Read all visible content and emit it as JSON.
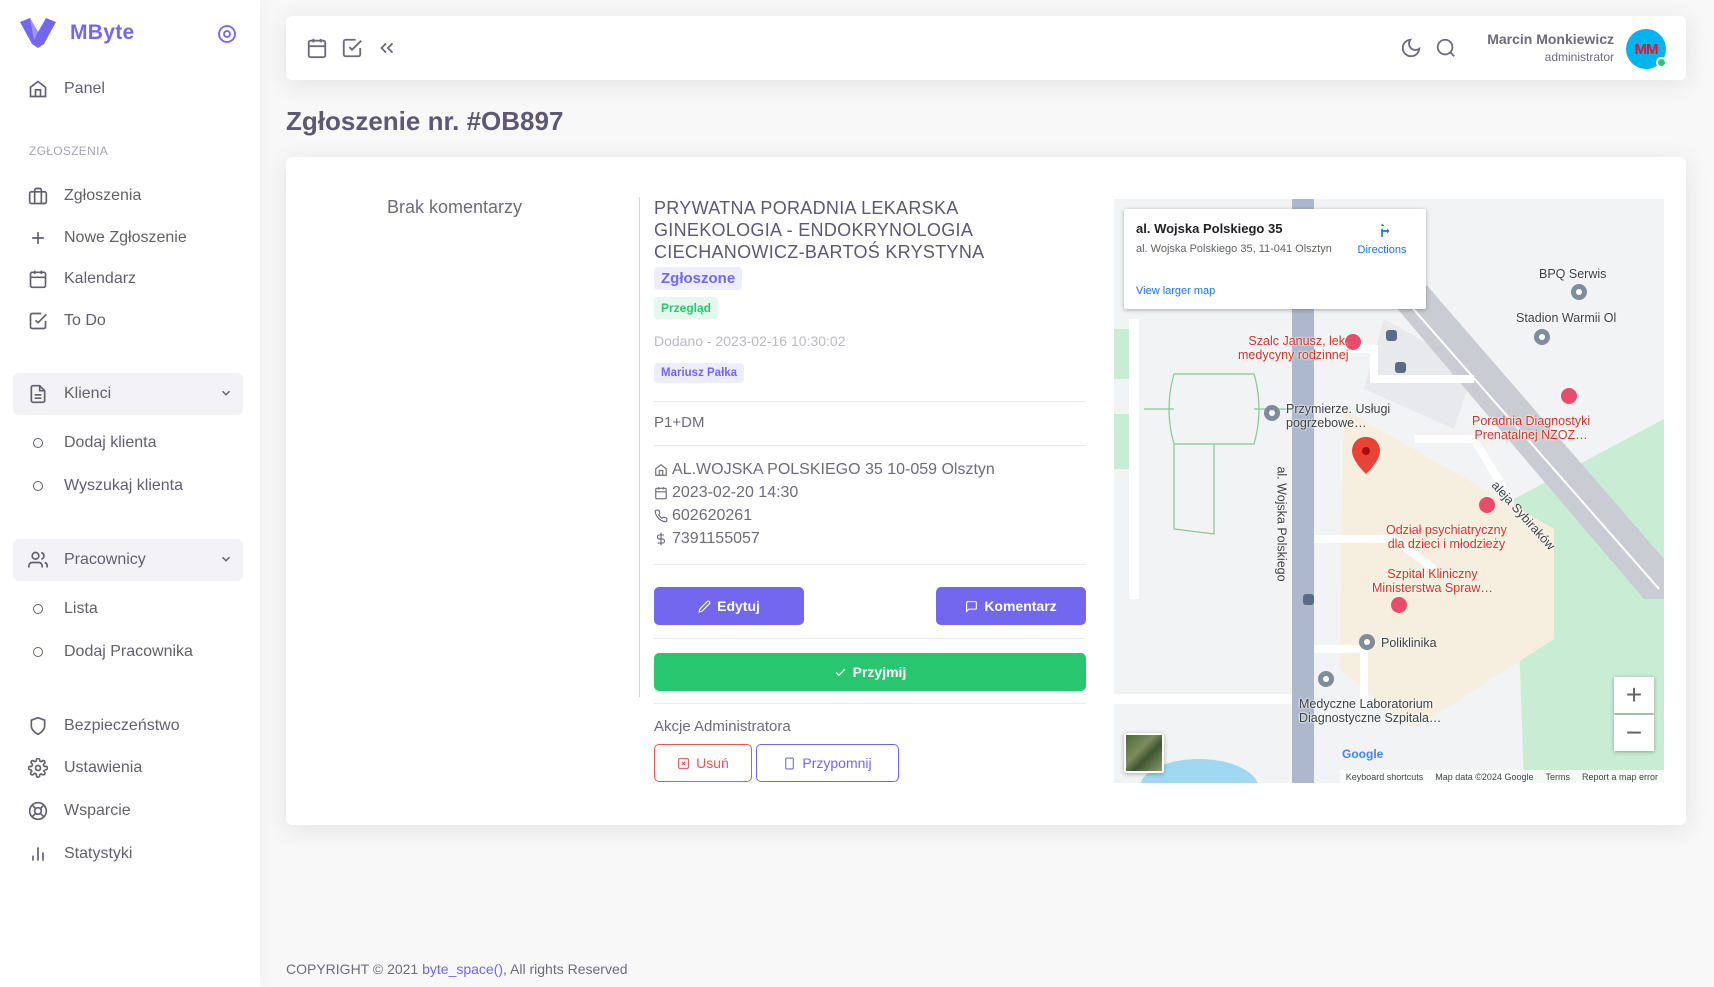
{
  "brand": {
    "name": "MByte"
  },
  "sidebar": {
    "top": [
      {
        "label": "Panel",
        "icon": "home-icon"
      }
    ],
    "section_label": "ZGŁOSZENIA",
    "items": [
      {
        "label": "Zgłoszenia",
        "icon": "briefcase-icon"
      },
      {
        "label": "Nowe Zgłoszenie",
        "icon": "plus-icon"
      },
      {
        "label": "Kalendarz",
        "icon": "calendar-icon"
      },
      {
        "label": "To Do",
        "icon": "check-square-icon"
      }
    ],
    "clients": {
      "label": "Klienci",
      "sub": [
        "Dodaj klienta",
        "Wyszukaj klienta"
      ]
    },
    "workers": {
      "label": "Pracownicy",
      "sub": [
        "Lista",
        "Dodaj Pracownika"
      ]
    },
    "bottom": [
      {
        "label": "Bezpieczeństwo",
        "icon": "shield-icon"
      },
      {
        "label": "Ustawienia",
        "icon": "gear-icon"
      },
      {
        "label": "Wsparcie",
        "icon": "lifebuoy-icon"
      },
      {
        "label": "Statystyki",
        "icon": "bar-chart-icon"
      }
    ]
  },
  "navbar": {
    "user_name": "Marcin Monkiewicz",
    "user_role": "administrator",
    "avatar_initials": "MM"
  },
  "page": {
    "title": "Zgłoszenie nr. #OB897"
  },
  "ticket": {
    "comments_empty": "Brak komentarzy",
    "clinic_name": "PRYWATNA PORADNIA LEKARSKA GINEKOLOGIA - ENDOKRYNOLOGIA CIECHANOWICZ-BARTOŚ KRYSTYNA",
    "status": "Zgłoszone",
    "type": "Przegląd",
    "added": "Dodano - 2023-02-16 10:30:02",
    "worker": "Mariusz Pałka",
    "code": "P1+DM",
    "address": "AL.WOJSKA POLSKIEGO 35 10-059 Olsztyn",
    "date": "2023-02-20 14:30",
    "phone": "602620261",
    "amount": "7391155057",
    "edit_label": "Edytuj",
    "comment_label": "Komentarz",
    "accept_label": "Przyjmij",
    "admin_actions_label": "Akcje Administratora",
    "delete_label": "Usuń",
    "remind_label": "Przypomnij"
  },
  "map": {
    "info_title": "al. Wojska Polskiego 35",
    "info_address": "al. Wojska Polskiego 35, 11-041 Olsztyn",
    "directions_label": "Directions",
    "larger_map_label": "View larger map",
    "labels": {
      "bpq": "BPQ Serwis",
      "stadion": "Stadion Warmii Ol",
      "szalc_1": "Szalc Janusz, lek.",
      "szalc_2": "medycyny rodzinnej",
      "przymierze_1": "Przymierze. Usługi",
      "przymierze_2": "pogrzebowe…",
      "poradnia_1": "Poradnia Diagnostyki",
      "poradnia_2": "Prenatalnej NZOZ…",
      "street_wp": "al. Wojska Polskiego",
      "street_syb": "aleja Sybiraków",
      "oddzial_1": "Odział psychiatryczny",
      "oddzial_2": "dla dzieci i młodzieży",
      "szpital_1": "Szpital Kliniczny",
      "szpital_2": "Ministerstwa Spraw…",
      "poliklinika": "Poliklinika",
      "lab_1": "Medyczne Laboratorium",
      "lab_2": "Diagnostyczne Szpitala…",
      "google": "Google"
    },
    "footer": {
      "shortcuts": "Keyboard shortcuts",
      "data": "Map data ©2024 Google",
      "terms": "Terms",
      "report": "Report a map error"
    }
  },
  "footer": {
    "prefix": "COPYRIGHT © 2021 ",
    "link": "byte_space()",
    "suffix": ", All rights Reserved"
  },
  "colors": {
    "primary": "#7367f0",
    "success": "#28c76f",
    "danger": "#ea5455"
  }
}
